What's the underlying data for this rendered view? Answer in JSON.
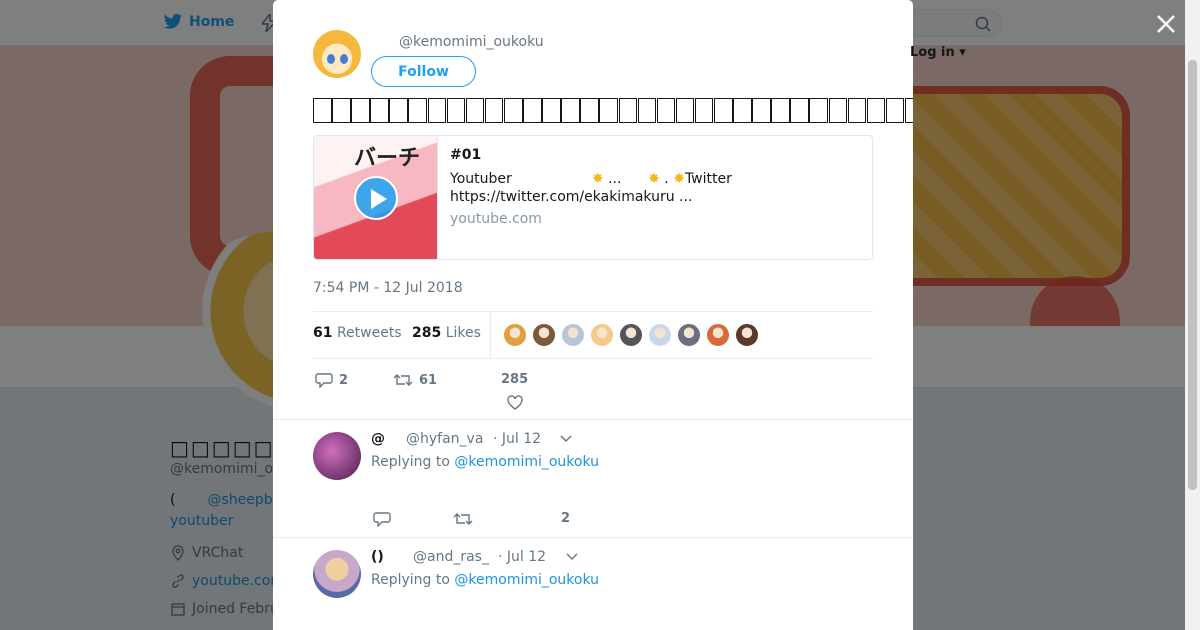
{
  "background": {
    "nav": {
      "home_label": "Home",
      "login_label": "Log in"
    },
    "profile": {
      "name": "□□□□□□□□□□",
      "handle": "@kemomimi_o",
      "bio_prefix": "(",
      "bio_link": "@sheepb",
      "bio_line2": "youtuber",
      "location": "VRChat",
      "website": "youtube.com",
      "joined": "Joined Febru"
    }
  },
  "modal": {
    "author": {
      "handle": "@kemomimi_oukoku",
      "follow_label": "Follow"
    },
    "tweet_glyph_count": 33,
    "card": {
      "thumb_text": "バーチ",
      "title": "#01",
      "desc_line1_a": "Youtuber",
      "desc_line1_b": "...",
      "desc_line1_c": ".",
      "desc_line1_d": "Twitter",
      "desc_line2": "https://twitter.com/ekakimakuru ...",
      "domain": "youtube.com"
    },
    "timestamp": "7:54 PM - 12 Jul 2018",
    "stats": {
      "retweets_count": "61",
      "retweets_label": "Retweets",
      "likes_count": "285",
      "likes_label": "Likes"
    },
    "likers": [
      "#e0a040",
      "#7a5a3a",
      "#b8c4d8",
      "#f5c98a",
      "#555555",
      "#c8d8ea",
      "#6a7080",
      "#d86a3a",
      "#5a3a2a"
    ],
    "actions": {
      "replies": "2",
      "retweets": "61",
      "likes": "285"
    },
    "replies": [
      {
        "name": "@",
        "handle": "@hyfan_va",
        "time": "· Jul 12",
        "replying_prefix": "Replying to",
        "replying_to": "@kemomimi_oukoku",
        "likes": "2",
        "avatar_color": "#8a3a7a"
      },
      {
        "name": "()",
        "handle": "@and_ras_",
        "time": "· Jul 12",
        "replying_prefix": "Replying to",
        "replying_to": "@kemomimi_oukoku",
        "avatar_color": "#c8a8c8"
      }
    ]
  },
  "colors": {
    "accent": "#1da1f2",
    "link": "#1b95e0",
    "muted": "#657786"
  }
}
